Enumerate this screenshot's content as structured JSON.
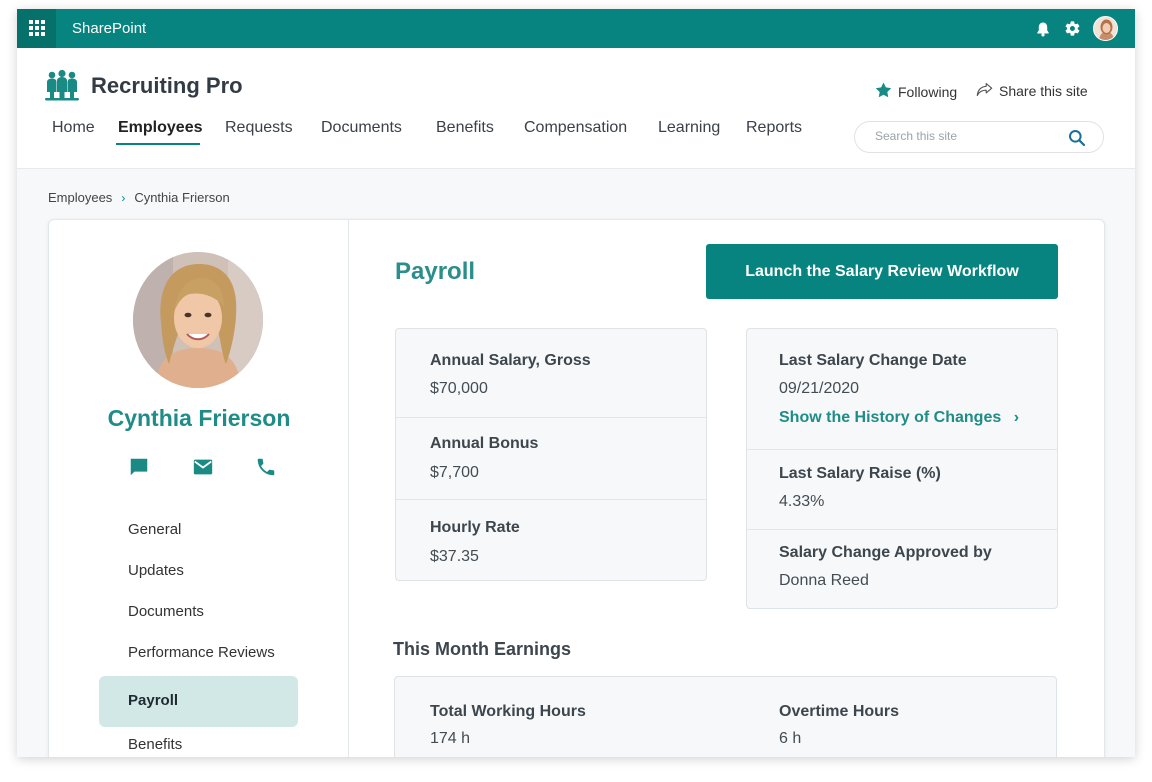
{
  "suite": {
    "title": "SharePoint",
    "icons": [
      "waffle-icon",
      "bell-icon",
      "gear-icon",
      "avatar"
    ]
  },
  "site": {
    "title": "Recruiting Pro",
    "follow_label": "Following",
    "share_label": "Share this site",
    "search_placeholder": "Search this site",
    "nav": [
      "Home",
      "Employees",
      "Requests",
      "Documents",
      "Benefits",
      "Compensation",
      "Learning",
      "Reports"
    ],
    "active_nav": "Employees"
  },
  "breadcrumb": [
    "Employees",
    "Cynthia Frierson"
  ],
  "profile": {
    "name": "Cynthia Frierson",
    "contact_icons": [
      "chat-icon",
      "mail-icon",
      "phone-icon"
    ],
    "menu": [
      "General",
      "Updates",
      "Documents",
      "Performance Reviews",
      "Payroll",
      "Benefits"
    ],
    "active_menu": "Payroll"
  },
  "payroll": {
    "title": "Payroll",
    "launch_button": "Launch the Salary Review Workflow",
    "left_panel": [
      {
        "label": "Annual Salary, Gross",
        "value": "$70,000"
      },
      {
        "label": "Annual Bonus",
        "value": "$7,700"
      },
      {
        "label": "Hourly Rate",
        "value": "$37.35"
      }
    ],
    "right_panel": {
      "last_change_label": "Last Salary Change Date",
      "last_change_value": "09/21/2020",
      "history_link": "Show the History of Changes",
      "raise_label": "Last Salary Raise (%)",
      "raise_value": "4.33%",
      "approved_label": "Salary Change Approved by",
      "approved_value": "Donna Reed"
    },
    "earnings_title": "This Month Earnings",
    "earnings": [
      {
        "label": "Total Working Hours",
        "value": "174 h"
      },
      {
        "label": "Overtime Hours",
        "value": "6 h"
      }
    ]
  },
  "colors": {
    "brand": "#07847f",
    "brand_dark": "#06706b",
    "accent_text": "#1f8c87",
    "active_menu_bg": "#d2e8e7"
  }
}
